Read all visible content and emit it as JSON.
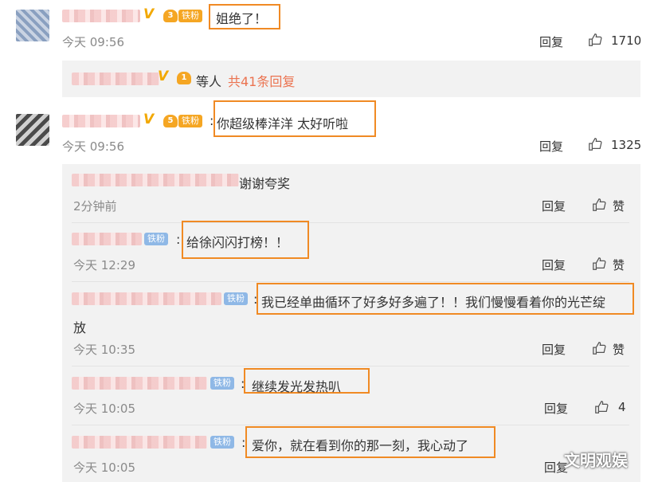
{
  "comments": [
    {
      "text": "姐绝了！",
      "time": "今天 09:56",
      "reply_label": "回复",
      "likes": "1710",
      "badge": "铁粉"
    },
    {
      "text": "你超级棒洋洋  太好听啦",
      "separator": ":",
      "time": "今天 09:56",
      "reply_label": "回复",
      "likes": "1325",
      "badge": "铁粉"
    }
  ],
  "summary": {
    "prefix": "等人",
    "link": "共41条回复"
  },
  "replies": [
    {
      "text": "谢谢夸奖",
      "time": "2分钟前",
      "reply_label": "回复",
      "like_label": "赞"
    },
    {
      "text": "给徐闪闪打榜！！",
      "separator": ":",
      "badge": "铁粉",
      "time": "今天 12:29",
      "reply_label": "回复",
      "like_label": "赞"
    },
    {
      "text": "我已经单曲循环了好多好多遍了！！我们慢慢看着你的光芒绽",
      "text_cont": "放",
      "separator": ":",
      "badge": "铁粉",
      "time": "今天 10:35",
      "reply_label": "回复",
      "like_label": "赞"
    },
    {
      "text": "继续发光发热叭",
      "separator": ":",
      "badge": "铁粉",
      "time": "今天 10:05",
      "reply_label": "回复",
      "likes": "4"
    },
    {
      "text": "爱你，就在看到你的那一刻，我心动了",
      "separator": ":",
      "badge": "铁粉",
      "time": "今天 10:05",
      "reply_label": "回复"
    }
  ],
  "watermark": "文明观娱",
  "colors": {
    "highlight_box": "#f08a24",
    "link": "#eb7350",
    "badge": "#f5a623",
    "badge_blue": "#8fb8e6"
  }
}
